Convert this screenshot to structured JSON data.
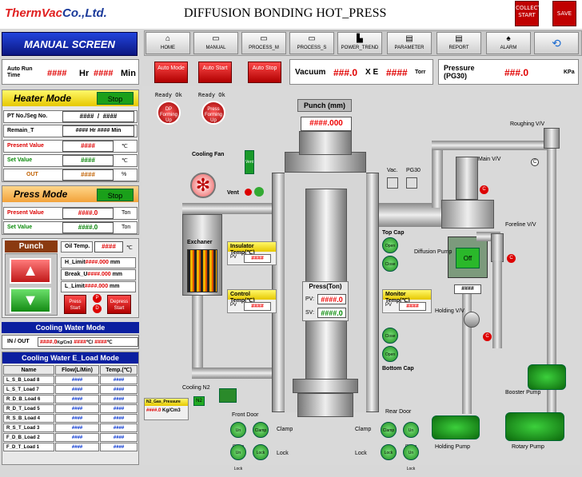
{
  "header": {
    "logo_red": "ThermVac",
    "logo_blue": "Co.,Ltd.",
    "title": "DIFFUSION BONDING HOT_PRESS",
    "collect_start": "COLLECT START",
    "save": "SAVE"
  },
  "nav": {
    "screen_title": "MANUAL SCREEN",
    "buttons": [
      {
        "label": "HOME",
        "icon": "home-icon"
      },
      {
        "label": "MANUAL",
        "icon": "manual-icon"
      },
      {
        "label": "PROCESS_M",
        "icon": "process-icon"
      },
      {
        "label": "PROCESS_S",
        "icon": "process-icon"
      },
      {
        "label": "POWER_TREND",
        "icon": "chart-icon"
      },
      {
        "label": "PARAMETER",
        "icon": "parameter-icon"
      },
      {
        "label": "REPORT",
        "icon": "report-icon"
      },
      {
        "label": "ALARM",
        "icon": "bell-icon"
      }
    ]
  },
  "run_time": {
    "label": "Auto Run Time",
    "hr_val": "####",
    "hr": "Hr",
    "min_val": "####",
    "min": "Min"
  },
  "auto": {
    "mode": "Auto Mode",
    "start": "Auto Start",
    "stop": "Auto Stop"
  },
  "vacuum": {
    "label": "Vacuum",
    "mant": "###.0",
    "xe": "X E",
    "exp": "####",
    "unit": "Torr"
  },
  "pressure": {
    "label": "Pressure (PG30)",
    "val": "###.0",
    "unit": "KPa"
  },
  "heater": {
    "title": "Heater Mode",
    "stop": "Stop",
    "pt_label": "PT No./Seg No.",
    "pt_a": "####",
    "pt_sep": "/",
    "pt_b": "####",
    "remain_label": "Remain_T",
    "remain_hr": "####",
    "hr": "Hr",
    "remain_min": "####",
    "min": "Min",
    "present_label": "Present Value",
    "present_val": "####",
    "deg": "℃",
    "set_label": "Set Value",
    "set_val": "####",
    "out_label": "OUT",
    "out_val": "####",
    "pct": "%"
  },
  "press": {
    "title": "Press Mode",
    "stop": "Stop",
    "present_label": "Present Value",
    "present_val": "####.0",
    "ton": "Ton",
    "set_label": "Set Value",
    "set_val": "####.0"
  },
  "punch": {
    "title": "Punch",
    "oil_label": "Oil Temp.",
    "oil_val": "####",
    "deg": "℃",
    "h_limit": "H_Limit",
    "h_val": "####.000",
    "break_u": "Break_U",
    "break_val": "####.000",
    "l_limit": "L_Limit",
    "l_val": "####.000",
    "mm": "mm",
    "press_start": "Press Start",
    "depress_start": "Depress Start",
    "p": "P",
    "d": "D"
  },
  "cooling_water": {
    "title": "Cooling Water  Mode",
    "io_label": "IN / OUT",
    "flow": "####.0",
    "flow_unit": "Kg/Cm3",
    "temp": "####",
    "temp_unit": "℃/",
    "temp2": "####",
    "temp2_unit": "℃"
  },
  "eload": {
    "title": "Cooling Water  E_Load Mode",
    "cols": [
      "Name",
      "Flow(L/Min)",
      "Temp.(℃)"
    ],
    "rows": [
      {
        "name": "L_S_B_Load 8",
        "flow": "####",
        "temp": "####"
      },
      {
        "name": "L_S_T_Load 7",
        "flow": "####",
        "temp": "####"
      },
      {
        "name": "R_D_B_Load 6",
        "flow": "####",
        "temp": "####"
      },
      {
        "name": "R_D_T_Load 5",
        "flow": "####",
        "temp": "####"
      },
      {
        "name": "R_S_B_Load 4",
        "flow": "####",
        "temp": "####"
      },
      {
        "name": "R_S_T_Load 3",
        "flow": "####",
        "temp": "####"
      },
      {
        "name": "F_D_B_Load 2",
        "flow": "####",
        "temp": "####"
      },
      {
        "name": "F_D_T_Load 1",
        "flow": "####",
        "temp": "####"
      }
    ]
  },
  "diagram": {
    "ready1": "Ready Ok",
    "ready2": "Ready Ok",
    "dp_forming": "DP Forming Up",
    "press_forming": "Press Forming Up",
    "punch_label": "Punch (mm)",
    "punch_val": "####.000",
    "cooling_fan": "Cooling Fan",
    "vent": "Vent",
    "vent_v": "Vent",
    "exchanger": "Exchaner",
    "insulator": "Insulator Temp(℃)",
    "control": "Control Temp(℃)",
    "monitor": "Monitor Temp(℃)",
    "pv": "PV",
    "temp_val": "####",
    "press_ton": "Press(Ton)",
    "pv_label": "PV:",
    "sv_label": "SV:",
    "press_pv": "####.0",
    "press_sv": "####.0",
    "vac": "Vac.",
    "pg30": "PG30",
    "top_cap": "Top Cap",
    "bottom_cap": "Bottom Cap",
    "open": "Open",
    "close": "Close",
    "roughing": "Roughing V/V",
    "main_vv": "Main V/V",
    "foreline": "Foreline V/V",
    "diffusion": "Diffusion Pump",
    "diff_off": "Off",
    "diff_val": "####",
    "holding_vv": "Holding V/V",
    "booster": "Booster Pump",
    "rotary": "Rotary Pump",
    "holding_pump": "Holding Pump",
    "cooling_n2": "Cooling N2",
    "n2_gas": "N2_Gas_Pressure",
    "n2_val": "####.0",
    "n2_unit": "Kg/Cm3",
    "n2": "N2",
    "front_door": "Front Door",
    "rear_door": "Rear Door",
    "clamp": "Clamp",
    "lock": "Lock",
    "unclamp": "Un Clamp",
    "unlock": "Un Lock",
    "c": "C"
  }
}
